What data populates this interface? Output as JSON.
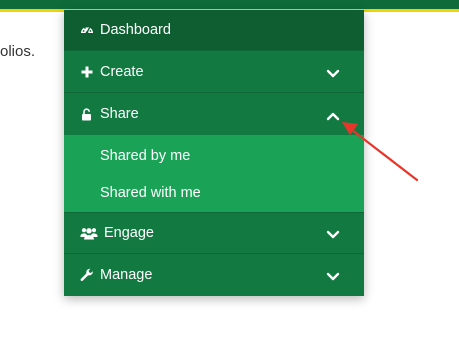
{
  "background": {
    "partial_text": "olios."
  },
  "menu": {
    "items": [
      {
        "label": "Dashboard",
        "icon": "dashboard-gauge-icon",
        "expanded": null
      },
      {
        "label": "Create",
        "icon": "plus-icon",
        "expanded": false
      },
      {
        "label": "Share",
        "icon": "unlock-icon",
        "expanded": true,
        "children": [
          {
            "label": "Shared by me"
          },
          {
            "label": "Shared with me"
          }
        ]
      },
      {
        "label": "Engage",
        "icon": "users-icon",
        "expanded": false
      },
      {
        "label": "Manage",
        "icon": "wrench-icon",
        "expanded": false
      }
    ]
  },
  "colors": {
    "menu_bg": "#127a41",
    "dashboard_bg": "#0e5e31",
    "submenu_bg": "#1aa356",
    "banner": "#0f6b3a",
    "banner_stripe": "#f2d400",
    "annotation_arrow": "#e8352a"
  },
  "annotation": {
    "type": "arrow",
    "points_to": "share-collapse-chevron"
  }
}
